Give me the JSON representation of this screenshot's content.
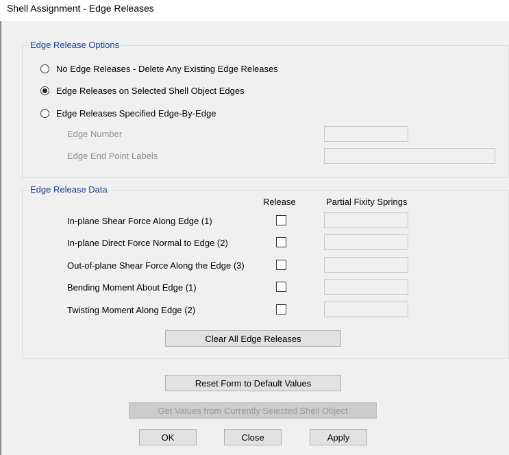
{
  "window": {
    "title": "Shell Assignment - Edge Releases"
  },
  "options": {
    "legend": "Edge Release Options",
    "radios": [
      {
        "label": "No Edge Releases - Delete Any Existing Edge Releases",
        "checked": false
      },
      {
        "label": "Edge Releases on Selected Shell Object Edges",
        "checked": true
      },
      {
        "label": "Edge Releases Specified Edge-By-Edge",
        "checked": false
      }
    ],
    "edge_number_label": "Edge Number",
    "edge_end_labels_label": "Edge End Point Labels"
  },
  "data": {
    "legend": "Edge Release Data",
    "release_header": "Release",
    "springs_header": "Partial Fixity Springs",
    "rows": [
      {
        "label": "In-plane Shear Force Along Edge (1)"
      },
      {
        "label": "In-plane Direct Force Normal to  Edge (2)"
      },
      {
        "label": "Out-of-plane Shear Force Along the Edge (3)"
      },
      {
        "label": "Bending Moment About Edge (1)"
      },
      {
        "label": "Twisting Moment Along Edge (2)"
      }
    ],
    "clear_button": "Clear All Edge Releases"
  },
  "buttons": {
    "reset": "Reset Form to Default Values",
    "get_values": "Get Values from Currently Selected Shell Object",
    "ok": "OK",
    "close": "Close",
    "apply": "Apply"
  }
}
